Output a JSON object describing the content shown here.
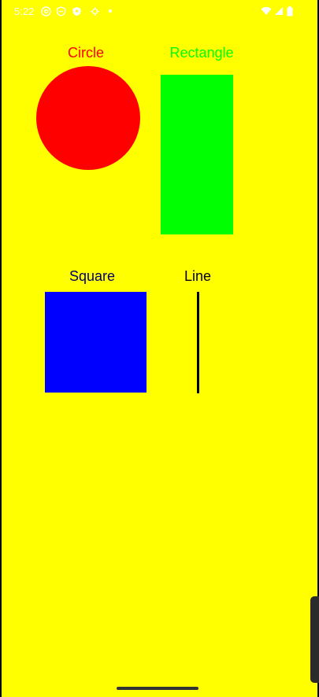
{
  "status_bar": {
    "time": "5:22",
    "left_icons": [
      "at-sign-icon",
      "shield-icon",
      "vpn-key-icon",
      "location-icon",
      "dot-icon"
    ],
    "right_icons": [
      "wifi-icon",
      "cell-signal-icon",
      "battery-icon"
    ]
  },
  "shapes": {
    "circle": {
      "label": "Circle",
      "color": "#ff0000"
    },
    "rectangle": {
      "label": "Rectangle",
      "color": "#00ff00"
    },
    "square": {
      "label": "Square",
      "color": "#0000ff",
      "label_color": "#000066"
    },
    "line": {
      "label": "Line",
      "color": "#000000",
      "label_color": "#000000"
    }
  },
  "theme": {
    "background": "#ffff00"
  }
}
